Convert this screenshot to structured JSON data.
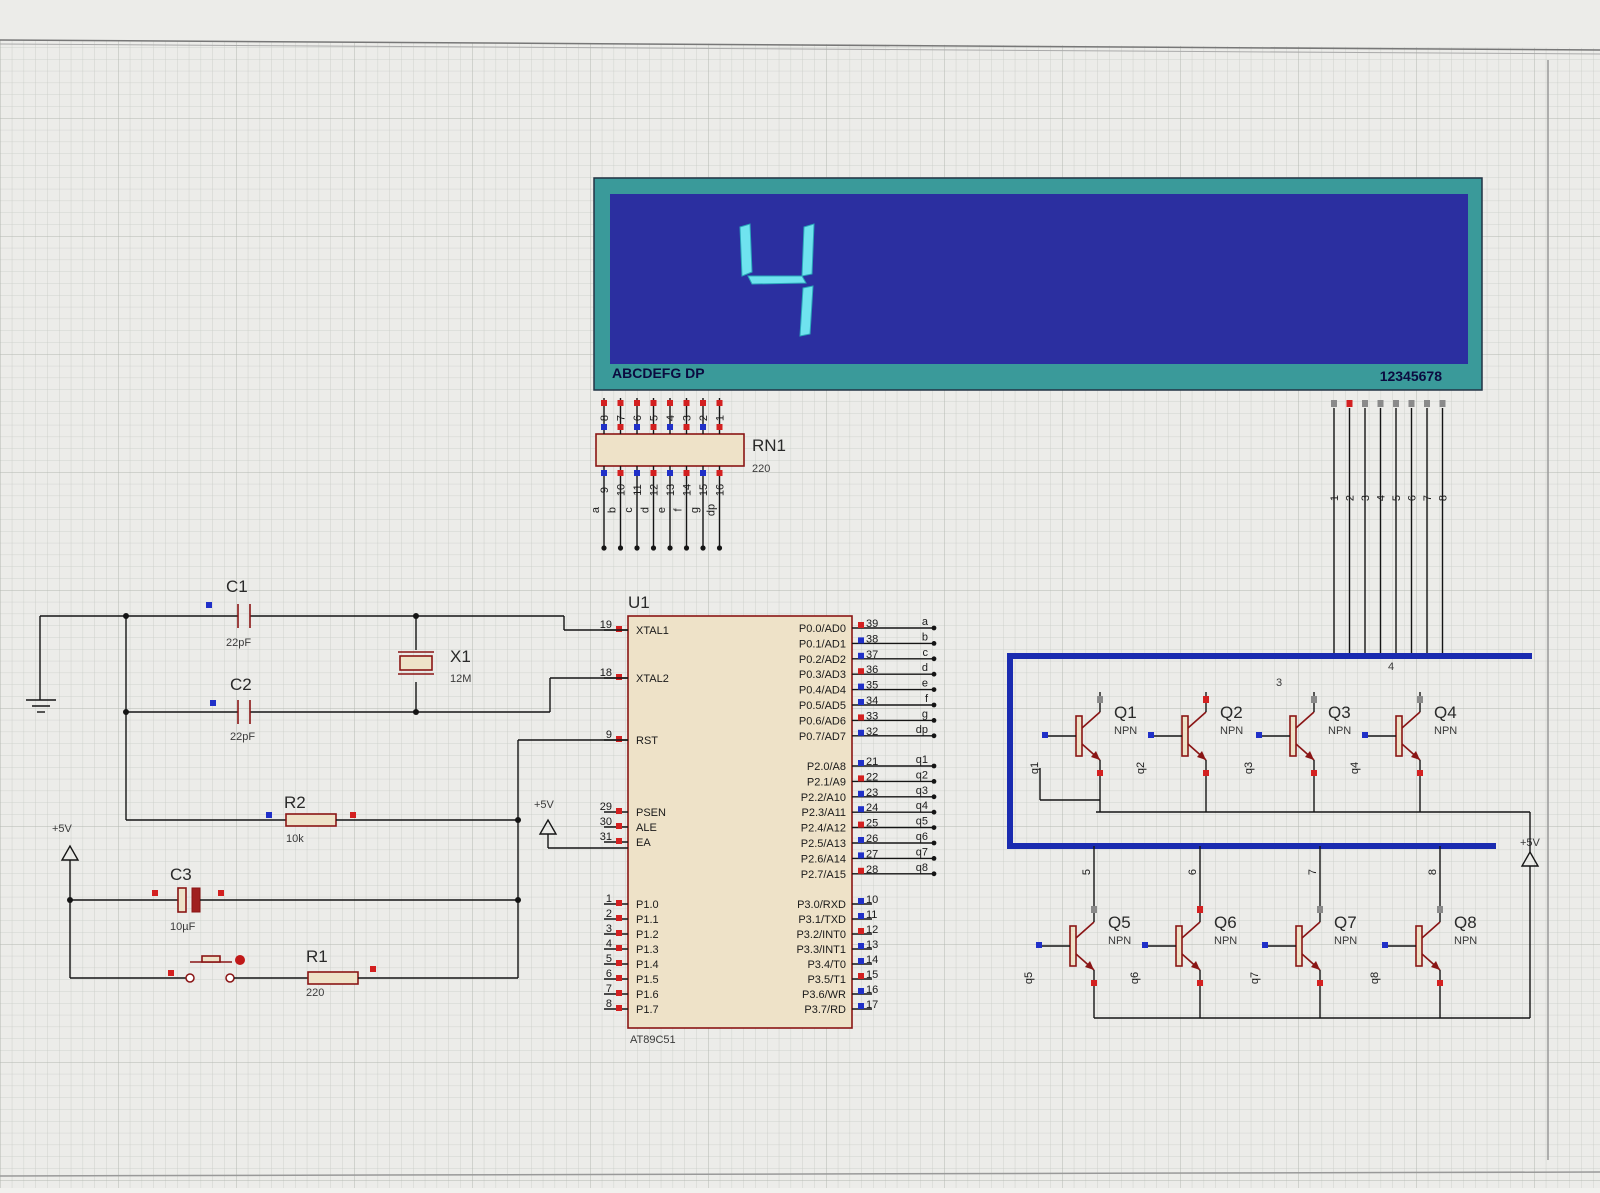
{
  "display": {
    "digit_shown": "4",
    "segments_label": "ABCDEFG DP",
    "digits_label": "12345678",
    "top_pin_numbers": [
      "8",
      "7",
      "6",
      "5",
      "4",
      "3",
      "2",
      "1"
    ],
    "accent": "#2b2fa0",
    "frame": "#3a9a9a",
    "segment_color": "#6fe3ef"
  },
  "rn1": {
    "ref": "RN1",
    "value": "220",
    "bottom_pins": [
      {
        "num": "9",
        "net": "a"
      },
      {
        "num": "10",
        "net": "b"
      },
      {
        "num": "11",
        "net": "c"
      },
      {
        "num": "12",
        "net": "d"
      },
      {
        "num": "13",
        "net": "e"
      },
      {
        "num": "14",
        "net": "f"
      },
      {
        "num": "15",
        "net": "g"
      },
      {
        "num": "16",
        "net": "dp"
      }
    ]
  },
  "digit_lines": [
    "1",
    "2",
    "3",
    "4",
    "5",
    "6",
    "7",
    "8"
  ],
  "mcu": {
    "ref": "U1",
    "part": "AT89C51",
    "left_pins": [
      {
        "num": "19",
        "name": "XTAL1"
      },
      {
        "num": "18",
        "name": "XTAL2"
      },
      {
        "num": "9",
        "name": "RST"
      },
      {
        "num": "29",
        "name": "PSEN"
      },
      {
        "num": "30",
        "name": "ALE"
      },
      {
        "num": "31",
        "name": "EA"
      },
      {
        "num": "1",
        "name": "P1.0"
      },
      {
        "num": "2",
        "name": "P1.1"
      },
      {
        "num": "3",
        "name": "P1.2"
      },
      {
        "num": "4",
        "name": "P1.3"
      },
      {
        "num": "5",
        "name": "P1.4"
      },
      {
        "num": "6",
        "name": "P1.5"
      },
      {
        "num": "7",
        "name": "P1.6"
      },
      {
        "num": "8",
        "name": "P1.7"
      }
    ],
    "right_pins": [
      {
        "num": "39",
        "name": "P0.0/AD0",
        "net": "a"
      },
      {
        "num": "38",
        "name": "P0.1/AD1",
        "net": "b"
      },
      {
        "num": "37",
        "name": "P0.2/AD2",
        "net": "c"
      },
      {
        "num": "36",
        "name": "P0.3/AD3",
        "net": "d"
      },
      {
        "num": "35",
        "name": "P0.4/AD4",
        "net": "e"
      },
      {
        "num": "34",
        "name": "P0.5/AD5",
        "net": "f"
      },
      {
        "num": "33",
        "name": "P0.6/AD6",
        "net": "g"
      },
      {
        "num": "32",
        "name": "P0.7/AD7",
        "net": "dp"
      },
      {
        "num": "21",
        "name": "P2.0/A8",
        "net": "q1"
      },
      {
        "num": "22",
        "name": "P2.1/A9",
        "net": "q2"
      },
      {
        "num": "23",
        "name": "P2.2/A10",
        "net": "q3"
      },
      {
        "num": "24",
        "name": "P2.3/A11",
        "net": "q4"
      },
      {
        "num": "25",
        "name": "P2.4/A12",
        "net": "q5"
      },
      {
        "num": "26",
        "name": "P2.5/A13",
        "net": "q6"
      },
      {
        "num": "27",
        "name": "P2.6/A14",
        "net": "q7"
      },
      {
        "num": "28",
        "name": "P2.7/A15",
        "net": "q8"
      },
      {
        "num": "10",
        "name": "P3.0/RXD",
        "net": ""
      },
      {
        "num": "11",
        "name": "P3.1/TXD",
        "net": ""
      },
      {
        "num": "12",
        "name": "P3.2/INT0",
        "net": ""
      },
      {
        "num": "13",
        "name": "P3.3/INT1",
        "net": ""
      },
      {
        "num": "14",
        "name": "P3.4/T0",
        "net": ""
      },
      {
        "num": "15",
        "name": "P3.5/T1",
        "net": ""
      },
      {
        "num": "16",
        "name": "P3.6/WR",
        "net": ""
      },
      {
        "num": "17",
        "name": "P3.7/RD",
        "net": ""
      }
    ]
  },
  "parts": {
    "c1": {
      "ref": "C1",
      "value": "22pF"
    },
    "c2": {
      "ref": "C2",
      "value": "22pF"
    },
    "x1": {
      "ref": "X1",
      "value": "12M"
    },
    "r2": {
      "ref": "R2",
      "value": "10k"
    },
    "c3": {
      "ref": "C3",
      "value": "10µF"
    },
    "r1": {
      "ref": "R1",
      "value": "220"
    }
  },
  "power": {
    "label": "+5V"
  },
  "transistors_top": [
    {
      "ref": "Q1",
      "type": "NPN",
      "base": "q1"
    },
    {
      "ref": "Q2",
      "type": "NPN",
      "base": "q2"
    },
    {
      "ref": "Q3",
      "type": "NPN",
      "base": "q3"
    },
    {
      "ref": "Q4",
      "type": "NPN",
      "base": "q4"
    }
  ],
  "transistors_bottom": [
    {
      "ref": "Q5",
      "type": "NPN",
      "base": "q5"
    },
    {
      "ref": "Q6",
      "type": "NPN",
      "base": "q6"
    },
    {
      "ref": "Q7",
      "type": "NPN",
      "base": "q7"
    },
    {
      "ref": "Q8",
      "type": "NPN",
      "base": "q8"
    }
  ],
  "bus_labels": {
    "top": [
      "3",
      "4"
    ],
    "bottom": [
      "5",
      "6",
      "7",
      "8"
    ]
  }
}
